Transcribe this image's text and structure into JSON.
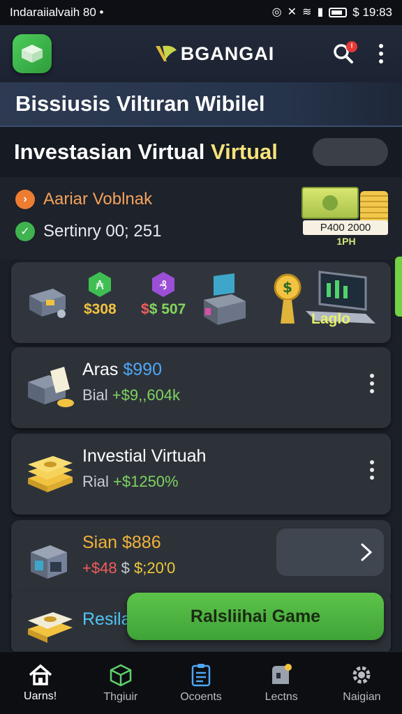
{
  "status_bar": {
    "left_text": "Indaraiialvaih  80  •",
    "time": "$ 19:83"
  },
  "app_bar": {
    "brand": "BGANGAI",
    "notification_count": "!"
  },
  "title_band": {
    "title": "Bissiusis Viltıran Wibilel"
  },
  "subtitle": {
    "text_main": "Investasian Virtual ",
    "text_highlight": "Virtual"
  },
  "info_panel": {
    "line1": "Aariar Voblnak",
    "line2": "Sertinry 00; 251",
    "cash_label": "P400 2000",
    "cash_sub": "1PH"
  },
  "icon_row": {
    "items": [
      {
        "icon": "machine-icon",
        "value": ""
      },
      {
        "icon": "green-gem-icon",
        "value": "$308"
      },
      {
        "icon": "purple-gem-icon",
        "value": "$ 507"
      },
      {
        "icon": "terminal-icon",
        "value": ""
      },
      {
        "icon": "laptop-coin-icon",
        "value": "Laglo"
      }
    ]
  },
  "cards": [
    {
      "name": "Aras ",
      "name_accent": "$990",
      "line2_prefix": "Bial ",
      "line2_value": "+$9,,604k"
    },
    {
      "name": "Investial Virtuah",
      "line2_prefix": "Rial ",
      "line2_value": "+$1250%"
    },
    {
      "name": "Sian $886",
      "line2_a": "+$48 ",
      "line2_b": "$ ",
      "line2_c": "$;20'0"
    },
    {
      "name": "Resila"
    }
  ],
  "cta": {
    "label": "Ralsliihai Game"
  },
  "bottom_nav": [
    {
      "label": "Uarns!",
      "icon": "home-icon"
    },
    {
      "label": "Thgiuir",
      "icon": "cube-icon"
    },
    {
      "label": "Ocoents",
      "icon": "document-icon"
    },
    {
      "label": "Lectns",
      "icon": "badge-icon"
    },
    {
      "label": "Naigian",
      "icon": "gear-icon"
    }
  ],
  "colors": {
    "accent_green": "#4fc34a",
    "accent_gold": "#f2c341",
    "accent_blue": "#4fa6f5"
  }
}
